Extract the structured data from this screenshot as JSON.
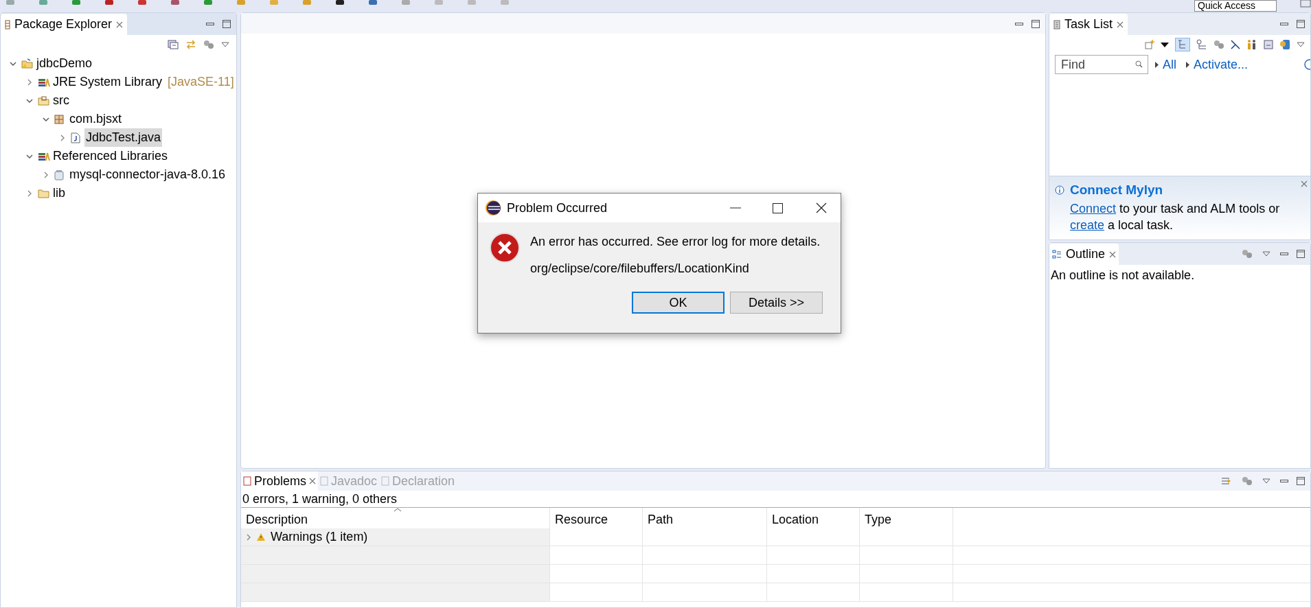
{
  "toolbar": {
    "quick_access": "Quick Access"
  },
  "package_explorer": {
    "title": "Package Explorer",
    "tree": [
      {
        "label": "jdbcDemo",
        "kind": "project",
        "expanded": true,
        "selected": false,
        "children": [
          {
            "label": "JRE System Library",
            "decoration": "[JavaSE-11]",
            "kind": "library",
            "expanded": false,
            "selected": false
          },
          {
            "label": "src",
            "kind": "source-folder",
            "expanded": true,
            "selected": false,
            "children": [
              {
                "label": "com.bjsxt",
                "kind": "package",
                "expanded": true,
                "selected": false,
                "children": [
                  {
                    "label": "JdbcTest.java",
                    "kind": "java-file",
                    "expanded": false,
                    "selected": true
                  }
                ]
              }
            ]
          },
          {
            "label": "Referenced Libraries",
            "kind": "library",
            "expanded": true,
            "selected": false,
            "children": [
              {
                "label": "mysql-connector-java-8.0.16",
                "kind": "jar",
                "expanded": false,
                "selected": false
              }
            ]
          },
          {
            "label": "lib",
            "kind": "folder",
            "expanded": false,
            "selected": false
          }
        ]
      }
    ]
  },
  "task_list": {
    "title": "Task List",
    "find_placeholder": "Find",
    "links": [
      "All",
      "Activate..."
    ]
  },
  "connect_mylyn": {
    "title": "Connect Mylyn",
    "lines": [
      [
        {
          "kind": "link",
          "text": "Connect"
        },
        {
          "kind": "text",
          "text": " to your task and ALM tools or"
        }
      ],
      [
        {
          "kind": "link",
          "text": "create"
        },
        {
          "kind": "text",
          "text": " a local task."
        }
      ]
    ]
  },
  "outline": {
    "title": "Outline",
    "message": "An outline is not available."
  },
  "bottom_panel": {
    "tabs": [
      {
        "label": "Problems",
        "selected": true
      },
      {
        "label": "Javadoc",
        "selected": false
      },
      {
        "label": "Declaration",
        "selected": false
      }
    ],
    "summary": "0 errors, 1 warning, 0 others",
    "columns": [
      "Description",
      "Resource",
      "Path",
      "Location",
      "Type"
    ],
    "rows": [
      {
        "description": "Warnings (1 item)",
        "expanded": false
      }
    ]
  },
  "dialog": {
    "title": "Problem Occurred",
    "message": "An error has occurred. See error log for more details.",
    "detail": "org/eclipse/core/filebuffers/LocationKind",
    "buttons": [
      {
        "label": "OK",
        "focused": true
      },
      {
        "label": "Details >>",
        "focused": false
      }
    ]
  }
}
